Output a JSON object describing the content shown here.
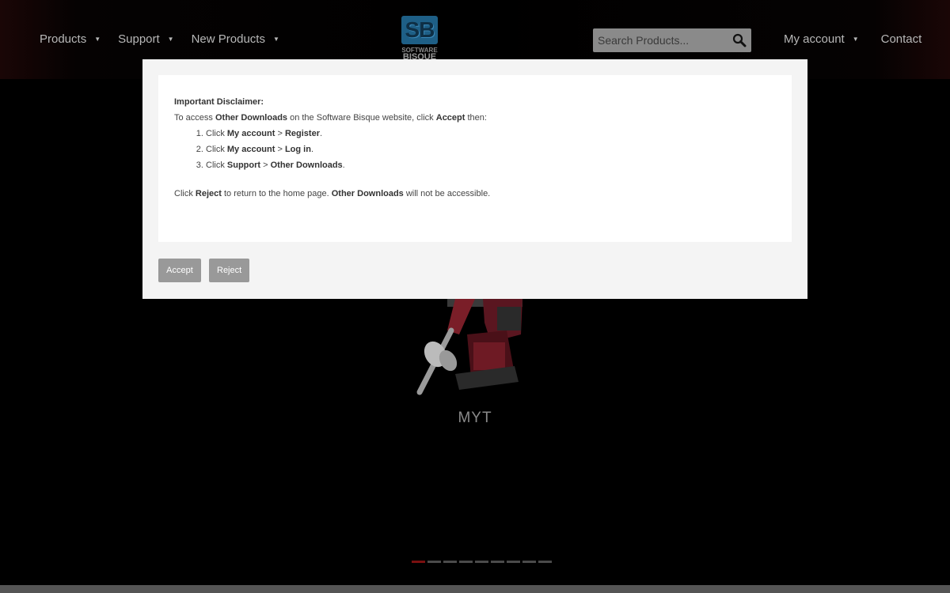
{
  "nav": {
    "products": "Products",
    "support": "Support",
    "new_products": "New Products",
    "my_account": "My account",
    "contact": "Contact"
  },
  "logo": {
    "mark": "SB",
    "line1": "SOFTWARE",
    "line2": "BISQUE"
  },
  "search": {
    "placeholder": "Search Products..."
  },
  "hero": {
    "caption": "MYT",
    "slide_count": 9,
    "active_slide": 1
  },
  "modal": {
    "title": "Important Disclaimer:",
    "intro_pre": "To access ",
    "intro_bold1": "Other Downloads",
    "intro_mid": " on the Software Bisque website, click ",
    "intro_bold2": "Accept",
    "intro_post": " then:",
    "steps": [
      {
        "pre": "Click ",
        "a": "My account",
        "sep": " > ",
        "b": "Register",
        "post": "."
      },
      {
        "pre": "Click ",
        "a": "My account",
        "sep": " > ",
        "b": "Log in",
        "post": "."
      },
      {
        "pre": "Click ",
        "a": "Support",
        "sep": " > ",
        "b": "Other Downloads",
        "post": "."
      }
    ],
    "reject_pre": "Click ",
    "reject_bold1": "Reject",
    "reject_mid": " to return to the home page. ",
    "reject_bold2": "Other Downloads",
    "reject_post": " will not be accessible.",
    "accept_label": "Accept",
    "reject_label": "Reject"
  },
  "colors": {
    "accent": "#7a1010",
    "logo_blue": "#1e5f86",
    "button_gray": "#999999"
  }
}
